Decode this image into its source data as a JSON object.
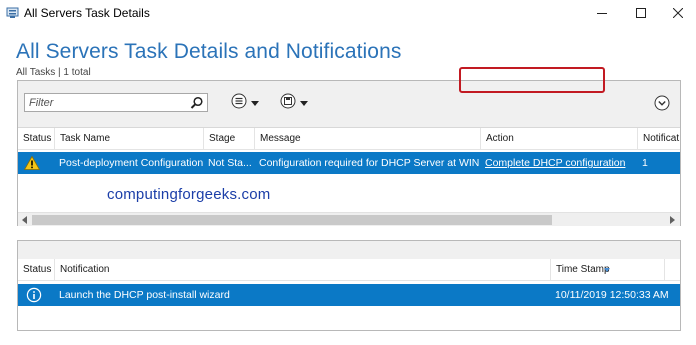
{
  "window": {
    "title": "All Servers Task Details",
    "minimize_icon": "minimize-icon",
    "maximize_icon": "maximize-icon",
    "close_icon": "close-icon"
  },
  "page": {
    "heading": "All Servers Task Details and Notifications",
    "subtitle": "All Tasks | 1 total"
  },
  "toolbar": {
    "filter_placeholder": "Filter",
    "search_icon": "search-icon",
    "view_icon": "list-options-icon",
    "save_icon": "save-icon",
    "expand_icon": "chevron-circle-down-icon"
  },
  "tasks_table": {
    "columns": [
      "Status",
      "Task Name",
      "Stage",
      "Message",
      "Action",
      "Notificat"
    ],
    "rows": [
      {
        "status_icon": "warning-icon",
        "task_name": "Post-deployment Configuration",
        "stage": "Not Sta...",
        "message": "Configuration required for DHCP Server at WIN...",
        "action": "Complete DHCP configuration",
        "notifications": "1"
      }
    ]
  },
  "watermark": "computingforgeeks.com",
  "notifications_table": {
    "columns": [
      "Status",
      "Notification",
      "Time Stamp"
    ],
    "rows": [
      {
        "status_icon": "info-icon",
        "notification": "Launch the DHCP post-install wizard",
        "time_stamp": "10/11/2019 12:50:33 AM"
      }
    ]
  },
  "colors": {
    "heading": "#2b73b8",
    "selection": "#0b79c6",
    "highlight_box": "#c21a22",
    "watermark": "#1b3ea8"
  }
}
